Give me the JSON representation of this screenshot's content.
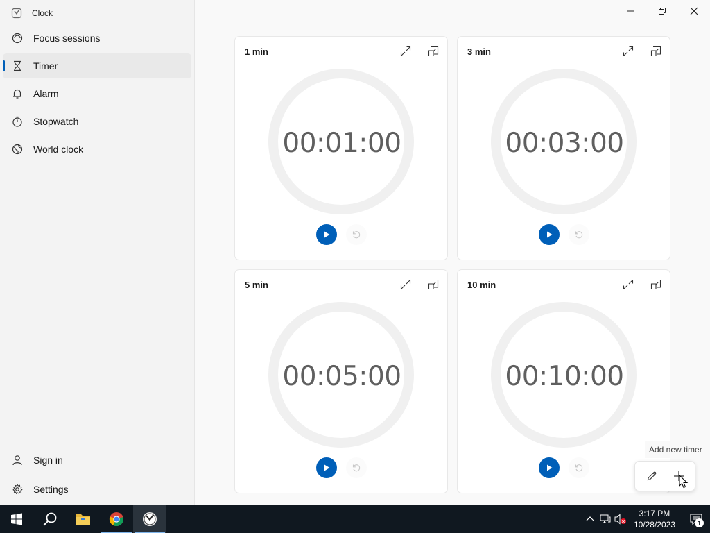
{
  "app": {
    "title": "Clock"
  },
  "nav": {
    "items": [
      {
        "label": "Focus sessions",
        "icon": "focus-icon"
      },
      {
        "label": "Timer",
        "icon": "hourglass-icon",
        "active": true
      },
      {
        "label": "Alarm",
        "icon": "bell-icon"
      },
      {
        "label": "Stopwatch",
        "icon": "stopwatch-icon"
      },
      {
        "label": "World clock",
        "icon": "globe-icon"
      }
    ],
    "bottom": [
      {
        "label": "Sign in",
        "icon": "person-icon"
      },
      {
        "label": "Settings",
        "icon": "gear-icon"
      }
    ]
  },
  "timers": [
    {
      "title": "1 min",
      "time": "00:01:00"
    },
    {
      "title": "3 min",
      "time": "00:03:00"
    },
    {
      "title": "5 min",
      "time": "00:05:00"
    },
    {
      "title": "10 min",
      "time": "00:10:00"
    }
  ],
  "fab": {
    "tooltip": "Add new timer"
  },
  "taskbar": {
    "time": "3:17 PM",
    "date": "10/28/2023",
    "notification_count": "1"
  },
  "colors": {
    "accent": "#005fb8",
    "taskbar": "#101820"
  }
}
